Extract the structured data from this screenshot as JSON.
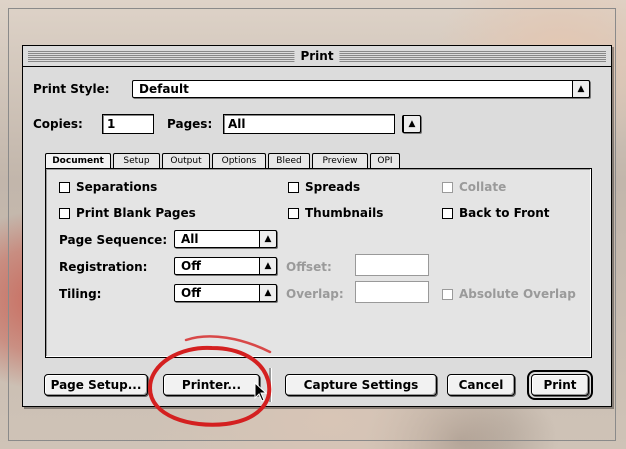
{
  "window": {
    "title": "Print"
  },
  "print_style": {
    "label": "Print Style:",
    "value": "Default"
  },
  "copies": {
    "label": "Copies:",
    "value": "1"
  },
  "pages": {
    "label": "Pages:",
    "value": "All"
  },
  "tabs": [
    {
      "label": "Document",
      "active": true
    },
    {
      "label": "Setup"
    },
    {
      "label": "Output"
    },
    {
      "label": "Options"
    },
    {
      "label": "Bleed"
    },
    {
      "label": "Preview"
    },
    {
      "label": "OPI"
    }
  ],
  "document": {
    "separations": "Separations",
    "spreads": "Spreads",
    "collate": "Collate",
    "print_blank_pages": "Print Blank Pages",
    "thumbnails": "Thumbnails",
    "back_to_front": "Back to Front",
    "page_sequence": {
      "label": "Page Sequence:",
      "value": "All"
    },
    "registration": {
      "label": "Registration:",
      "value": "Off"
    },
    "offset": {
      "label": "Offset:",
      "value": ""
    },
    "tiling": {
      "label": "Tiling:",
      "value": "Off"
    },
    "overlap": {
      "label": "Overlap:",
      "value": ""
    },
    "absolute_overlap": "Absolute Overlap"
  },
  "buttons": {
    "page_setup": "Page Setup...",
    "printer": "Printer...",
    "capture_settings": "Capture Settings",
    "cancel": "Cancel",
    "print": "Print"
  },
  "colors": {
    "annotation_circle": "#d42020",
    "dialog_bg": "#dcdcdc"
  },
  "icons": {
    "popup": "up-down-arrows-icon",
    "cursor": "arrow-cursor-icon"
  }
}
